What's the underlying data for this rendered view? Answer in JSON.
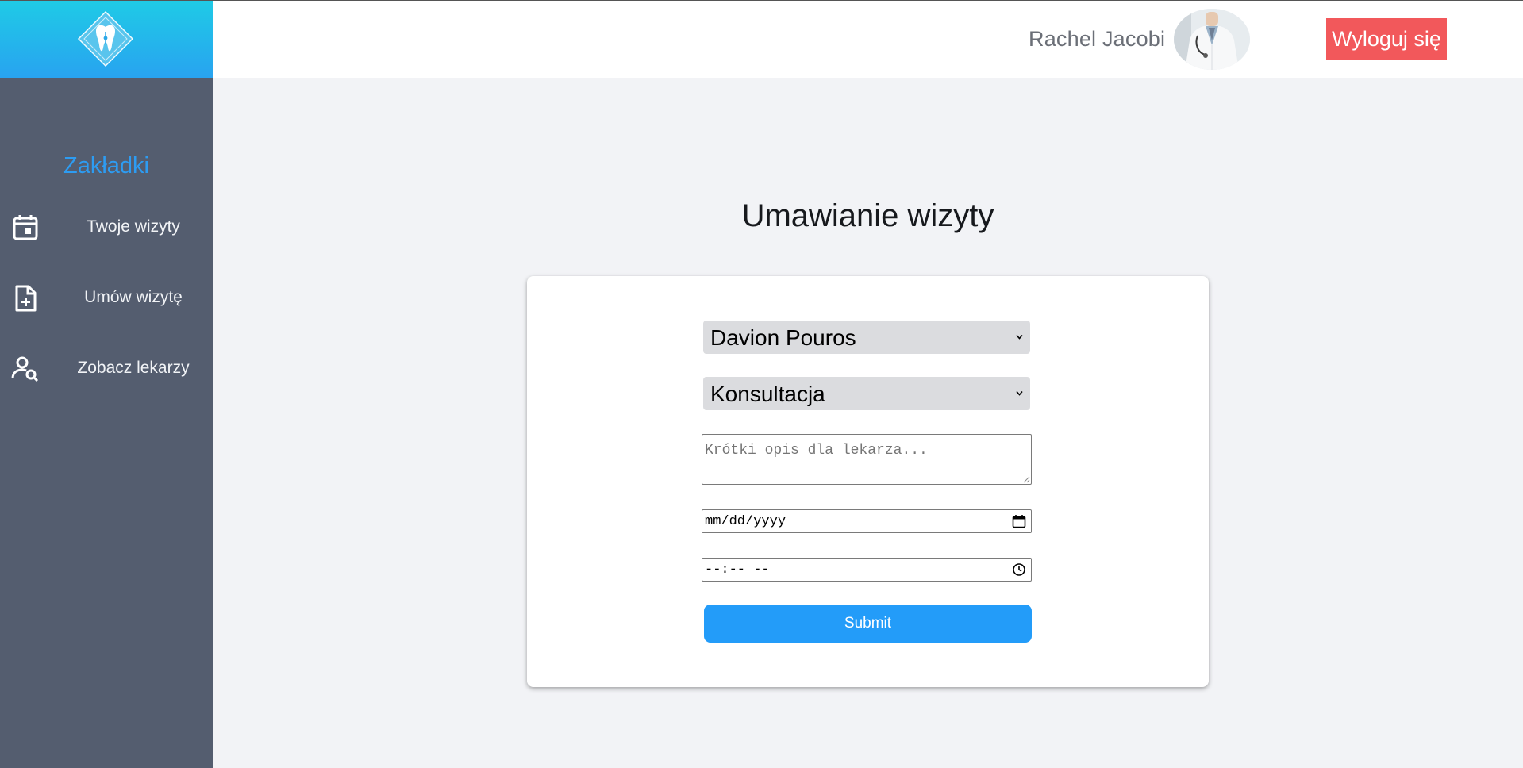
{
  "header": {
    "user_name": "Rachel Jacobi",
    "logout_label": "Wyloguj się"
  },
  "sidebar": {
    "heading": "Zakładki",
    "items": [
      {
        "label": "Twoje wizyty",
        "icon": "calendar-icon"
      },
      {
        "label": "Umów wizytę",
        "icon": "file-plus-icon"
      },
      {
        "label": "Zobacz lekarzy",
        "icon": "user-search-icon"
      }
    ]
  },
  "main": {
    "title": "Umawianie wizyty",
    "form": {
      "doctor_select_value": "Davion Pouros",
      "type_select_value": "Konsultacja",
      "description_placeholder": "Krótki opis dla lekarza...",
      "date_value": "mm/dd/yyyy",
      "time_value": "--:-- --",
      "submit_label": "Submit"
    }
  },
  "colors": {
    "accent": "#2d9cf2",
    "logout": "#f2585b",
    "sidebar": "#545d6f",
    "submit": "#239cf9"
  }
}
